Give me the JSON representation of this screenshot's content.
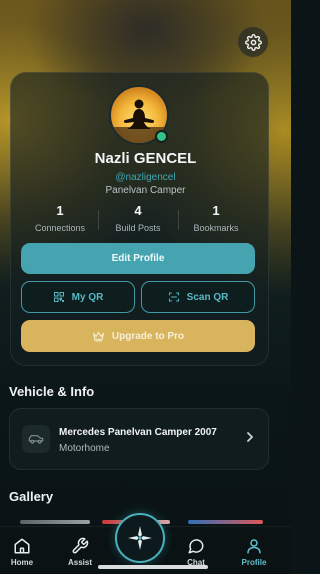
{
  "profile": {
    "name": "Nazli GENCEL",
    "handle": "@nazligencel",
    "role": "Panelvan Camper",
    "online": true
  },
  "stats": [
    {
      "value": "1",
      "label": "Connections"
    },
    {
      "value": "4",
      "label": "Build Posts"
    },
    {
      "value": "1",
      "label": "Bookmarks"
    }
  ],
  "actions": {
    "edit_profile": "Edit Profile",
    "my_qr": "My QR",
    "scan_qr": "Scan QR",
    "upgrade": "Upgrade to Pro"
  },
  "sections": {
    "vehicle_title": "Vehicle & Info",
    "gallery_title": "Gallery"
  },
  "vehicle": {
    "name": "Mercedes Panelvan Camper 2007",
    "type": "Motorhome"
  },
  "nav": {
    "items": [
      {
        "label": "Home",
        "icon": "home-icon"
      },
      {
        "label": "Assist",
        "icon": "wrench-icon"
      },
      {
        "label": "",
        "icon": "compass-icon"
      },
      {
        "label": "Chat",
        "icon": "chat-icon"
      },
      {
        "label": "Profile",
        "icon": "profile-icon",
        "active": true
      }
    ]
  },
  "colors": {
    "accent": "#46a4b0",
    "gold": "#d8b45c",
    "online": "#33c38a",
    "background": "#0b1417"
  }
}
